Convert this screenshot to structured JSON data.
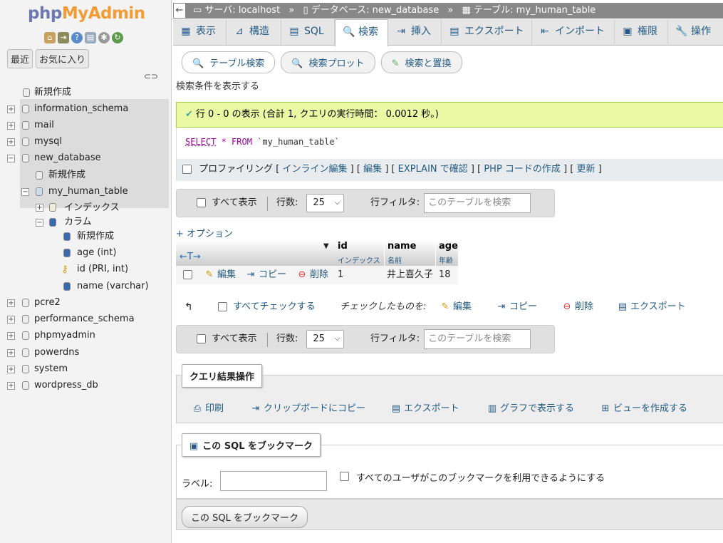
{
  "sidebar": {
    "logo_php": "php",
    "logo_ma": "MyAdmin",
    "quick_icons": [
      "home-icon",
      "logout-icon",
      "help-icon",
      "docs-icon",
      "settings-icon",
      "reload-icon"
    ],
    "recent_label": "最近",
    "favorites_label": "お気に入り",
    "tree": [
      {
        "label": "新規作成"
      },
      {
        "label": "information_schema"
      },
      {
        "label": "mail"
      },
      {
        "label": "mysql"
      },
      {
        "label": "new_database"
      },
      {
        "label": "新規作成"
      },
      {
        "label": "my_human_table"
      },
      {
        "label": "インデックス"
      },
      {
        "label": "カラム"
      },
      {
        "label": "新規作成"
      },
      {
        "label": "age (int)"
      },
      {
        "label": "id (PRI, int)"
      },
      {
        "label": "name (varchar)"
      },
      {
        "label": "pcre2"
      },
      {
        "label": "performance_schema"
      },
      {
        "label": "phpmyadmin"
      },
      {
        "label": "powerdns"
      },
      {
        "label": "system"
      },
      {
        "label": "wordpress_db"
      }
    ]
  },
  "breadcrumb": {
    "server": "サーバ: localhost",
    "sep1": "»",
    "database": "データベース: new_database",
    "sep2": "»",
    "table": "テーブル: my_human_table"
  },
  "tabs": [
    "表示",
    "構造",
    "SQL",
    "検索",
    "挿入",
    "エクスポート",
    "インポート",
    "権限",
    "操作"
  ],
  "active_tab": "検索",
  "subtabs": [
    "テーブル検索",
    "検索プロット",
    "検索と置換"
  ],
  "show_criteria": "検索条件を表示する",
  "success_message": "行 0 - 0 の表示 (合計 1, クエリの実行時間： 0.0012 秒。)",
  "sql": {
    "select": "SELECT",
    "star": " * ",
    "from": "FROM",
    "table": " `my_human_table`"
  },
  "profiling": {
    "label": "プロファイリング",
    "bracket_open": "[",
    "bracket_sep": "] [",
    "bracket_close": "]",
    "inline_edit": "インライン編集",
    "edit": "編集",
    "explain": "EXPLAIN で確認",
    "php_code": "PHP コードの作成",
    "refresh": "更新"
  },
  "nav": {
    "show_all": "すべて表示",
    "rows_label": "行数:",
    "rows_value": "25",
    "filter_label": "行フィルタ:",
    "filter_placeholder": "このテーブルを検索"
  },
  "options_link": "+ オプション",
  "columns": [
    {
      "name": "id",
      "comment": "インデックス"
    },
    {
      "name": "name",
      "comment": "名前"
    },
    {
      "name": "age",
      "comment": "年齢"
    }
  ],
  "row_actions": {
    "edit": "編集",
    "copy": "コピー",
    "delete": "削除"
  },
  "rows": [
    {
      "id": "1",
      "name": "井上喜久子",
      "age": "18"
    }
  ],
  "bulk": {
    "check_all": "すべてチェックする",
    "with_selected": "チェックしたものを:",
    "edit": "編集",
    "copy": "コピー",
    "delete": "削除",
    "export": "エクスポート"
  },
  "query_ops": {
    "legend": "クエリ結果操作",
    "print": "印刷",
    "copy_clipboard": "クリップボードにコピー",
    "export": "エクスポート",
    "chart": "グラフで表示する",
    "create_view": "ビューを作成する"
  },
  "bookmark": {
    "legend": "この SQL をブックマーク",
    "label": "ラベル:",
    "share": "すべてのユーザがこのブックマークを利用できるようにする",
    "button": "この SQL をブックマーク"
  }
}
